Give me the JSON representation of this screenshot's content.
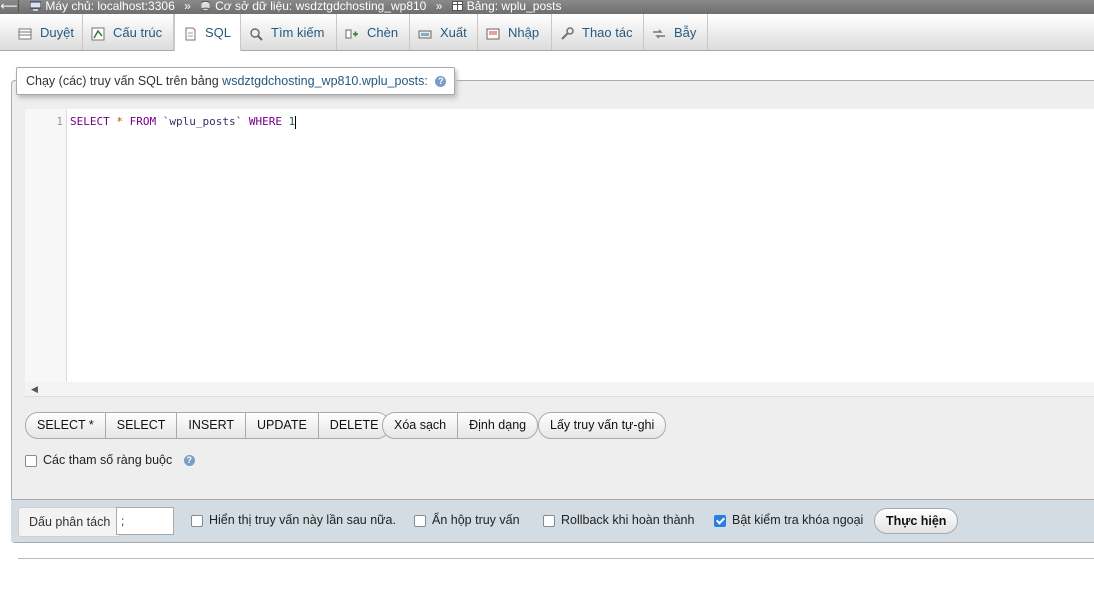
{
  "breadcrumb": {
    "server": "Máy chủ: localhost:3306",
    "database": "Cơ sở dữ liệu: wsdztgdchosting_wp810",
    "table": "Bảng: wplu_posts",
    "separator": "»"
  },
  "tabs": [
    {
      "label": "Duyệt",
      "icon": "browse-icon"
    },
    {
      "label": "Cấu trúc",
      "icon": "structure-icon"
    },
    {
      "label": "SQL",
      "icon": "sql-icon",
      "active": true
    },
    {
      "label": "Tìm kiếm",
      "icon": "search-icon"
    },
    {
      "label": "Chèn",
      "icon": "insert-icon"
    },
    {
      "label": "Xuất",
      "icon": "export-icon"
    },
    {
      "label": "Nhập",
      "icon": "import-icon"
    },
    {
      "label": "Thao tác",
      "icon": "wrench-icon"
    },
    {
      "label": "Bẫy",
      "icon": "triggers-icon"
    }
  ],
  "legend": {
    "prefix": "Chạy (các) truy vấn SQL trên bảng",
    "target": "wsdztgdchosting_wp810.wplu_posts:"
  },
  "editor": {
    "line_number": "1",
    "tokens": {
      "select": "SELECT",
      "star": "*",
      "from": "FROM",
      "table": "`wplu_posts`",
      "where": "WHERE",
      "one": "1"
    }
  },
  "query_buttons": {
    "select_star": "SELECT *",
    "select": "SELECT",
    "insert": "INSERT",
    "update": "UPDATE",
    "delete": "DELETE"
  },
  "edit_buttons": {
    "clear": "Xóa sạch",
    "format": "Định dạng"
  },
  "bookmark_button": "Lấy truy vấn tự-ghi",
  "bind_params": {
    "label": "Các tham số ràng buộc",
    "checked": false
  },
  "options": {
    "delimiter_label": "Dấu phân tách",
    "delimiter_value": ";",
    "show_again": {
      "label": "Hiển thị truy vấn này lần sau nữa.",
      "checked": false
    },
    "hide_box": {
      "label": "Ẩn hộp truy vấn",
      "checked": false
    },
    "rollback": {
      "label": "Rollback khi hoàn thành",
      "checked": false
    },
    "fk_check": {
      "label": "Bật kiểm tra khóa ngoại",
      "checked": true
    },
    "go_label": "Thực hiện"
  },
  "colors": {
    "link_blue": "#235a81",
    "options_bar": "#d3dce3",
    "checkbox_checked": "#2a7de1"
  }
}
